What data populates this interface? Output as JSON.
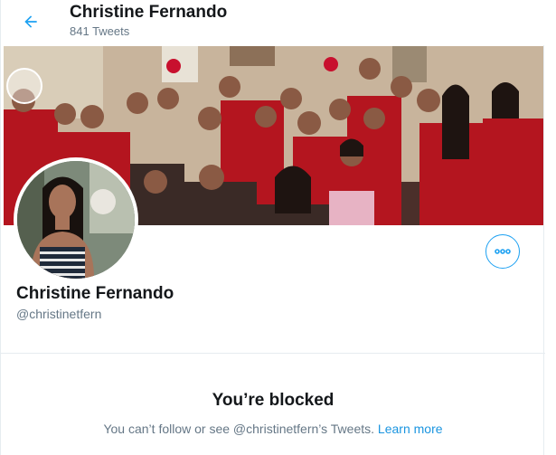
{
  "header": {
    "name": "Christine Fernando",
    "tweet_count": "841 Tweets",
    "back_icon": "arrow-left-icon"
  },
  "profile": {
    "name": "Christine Fernando",
    "handle": "@christinetfern",
    "more_icon": "more-horizontal-icon"
  },
  "blocked": {
    "title": "You’re blocked",
    "message": "You can’t follow or see @christinetfern’s Tweets.",
    "learn_more": "Learn more"
  },
  "colors": {
    "accent": "#1da1f2",
    "link": "#1b95e0",
    "text_primary": "#14171a",
    "text_secondary": "#657786",
    "border": "#e6ecf0"
  }
}
